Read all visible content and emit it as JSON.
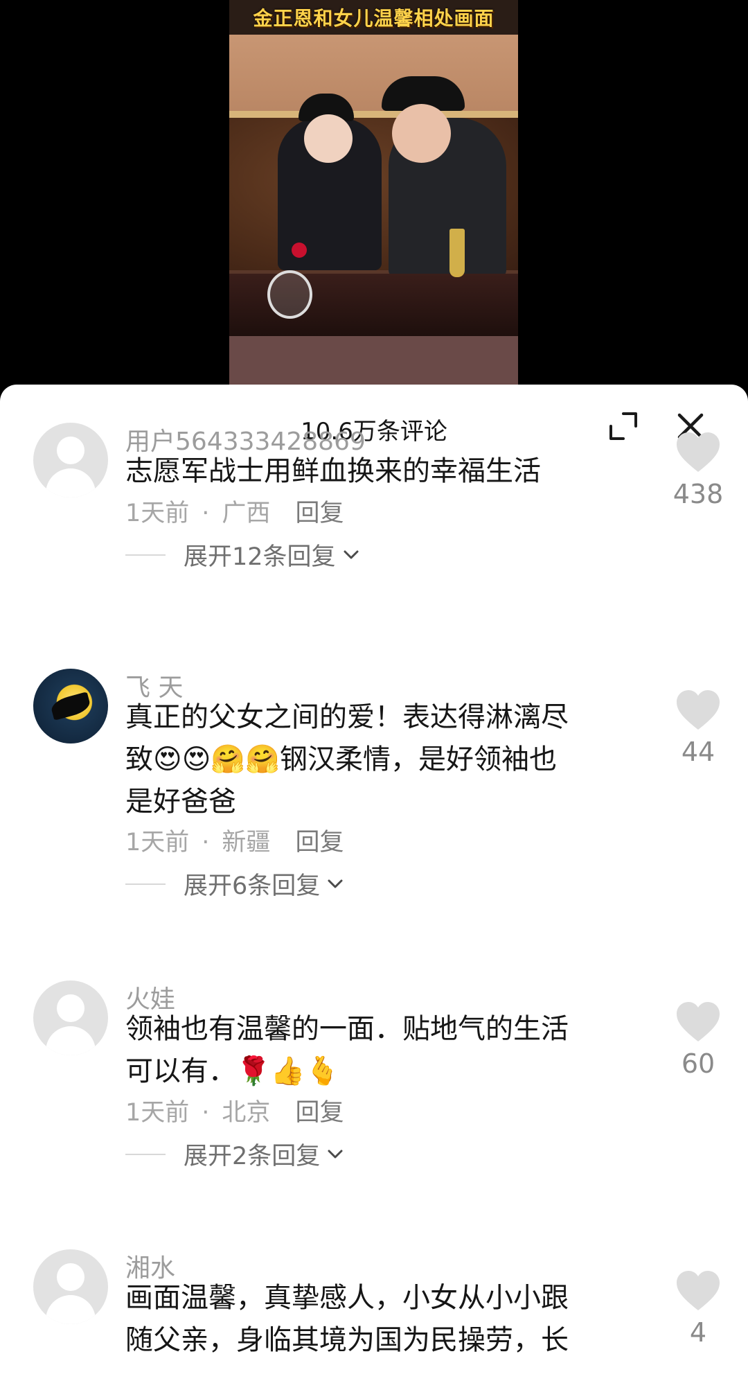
{
  "video": {
    "title": "金正恩和女儿温馨相处画面"
  },
  "sheet": {
    "comment_count": "10.6万条评论",
    "expand_icon": "expand-icon",
    "close_icon": "close-icon"
  },
  "comments": [
    {
      "username": "用户564333428869",
      "content": "志愿军战士用鲜血换来的幸福生活",
      "time": "1天前",
      "location": "广西",
      "reply_label": "回复",
      "expand_label": "展开12条回复",
      "likes": "438",
      "avatar": "default-avatar"
    },
    {
      "username": "飞 天",
      "content_line1": "真正的父女之间的爱！表达得淋漓尽",
      "content_line2_prefix": "致",
      "content_line2_emoji": "😍😍🤗🤗",
      "content_line2_suffix": "钢汉柔情，是好领袖也",
      "content_line3": "是好爸爸",
      "time": "1天前",
      "location": "新疆",
      "reply_label": "回复",
      "expand_label": "展开6条回复",
      "likes": "44",
      "avatar": "moon-avatar"
    },
    {
      "username": "火娃",
      "content_line1": "领袖也有温馨的一面．贴地气的生活",
      "content_line2_prefix": "可以有．",
      "content_line2_emoji": "🌹👍🫰",
      "time": "1天前",
      "location": "北京",
      "reply_label": "回复",
      "expand_label": "展开2条回复",
      "likes": "60",
      "avatar": "default-avatar"
    },
    {
      "username": "湘水",
      "content_line1": "画面温馨，真挚感人，小女从小小跟",
      "content_line2": "随父亲，身临其境为国为民操劳，长",
      "likes": "4",
      "avatar": "default-avatar"
    }
  ],
  "colors": {
    "sheet_bg": "#ffffff",
    "text_primary": "#161616",
    "text_secondary": "#9c9c9c",
    "like_icon": "#dcdcdc"
  }
}
